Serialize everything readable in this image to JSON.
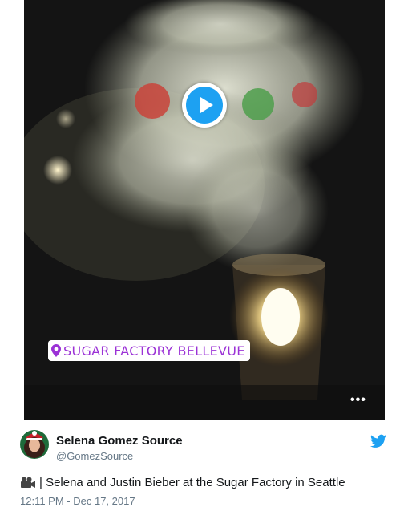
{
  "media": {
    "location_sticker": "SUGAR FACTORY BELLEVUE",
    "more_label": "•••"
  },
  "author": {
    "name": "Selena Gomez Source",
    "handle": "@GomezSource"
  },
  "tweet": {
    "text": "| Selena and Justin Bieber at the Sugar Factory in Seattle",
    "timestamp": "12:11 PM - Dec 17, 2017"
  },
  "icons": {
    "play": "play-icon",
    "pin": "location-pin-icon",
    "twitter": "twitter-bird-icon",
    "camera": "movie-camera-icon"
  },
  "colors": {
    "twitter_blue": "#1da1f2",
    "sticker_purple": "#9b32d6",
    "secondary_text": "#657786"
  }
}
